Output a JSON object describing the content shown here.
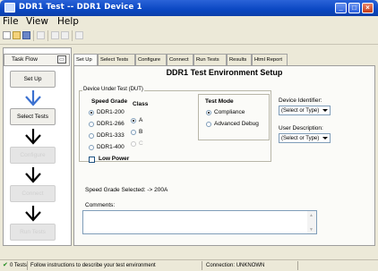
{
  "window": {
    "title": "DDR1 Test -- DDR1 Device 1"
  },
  "menu": [
    "File",
    "View",
    "Help"
  ],
  "task_flow": {
    "label": "Task Flow",
    "steps": [
      {
        "label": "Set Up",
        "enabled": true
      },
      {
        "label": "Select Tests",
        "enabled": true
      },
      {
        "label": "Configure",
        "enabled": false
      },
      {
        "label": "Connect",
        "enabled": false
      },
      {
        "label": "Run Tests",
        "enabled": false
      }
    ]
  },
  "tabs": [
    {
      "label": "Set Up",
      "active": true
    },
    {
      "label": "Select Tests",
      "active": false
    },
    {
      "label": "Configure",
      "active": false
    },
    {
      "label": "Connect",
      "active": false
    },
    {
      "label": "Run Tests",
      "active": false
    },
    {
      "label": "Results",
      "active": false
    },
    {
      "label": "Html Report",
      "active": false
    }
  ],
  "setup": {
    "title": "DDR1 Test Environment Setup",
    "dut_label": "Device Under Test (DUT)",
    "speed_grade": {
      "label": "Speed Grade",
      "options": [
        "DDR1-200",
        "DDR1-266",
        "DDR1-333",
        "DDR1-400"
      ],
      "selected": "DDR1-200"
    },
    "class": {
      "label": "Class",
      "options": [
        "A",
        "B",
        "C"
      ],
      "selected": "A"
    },
    "low_power": {
      "label": "Low Power",
      "checked": false
    },
    "test_mode": {
      "label": "Test Mode",
      "options": [
        "Compliance",
        "Advanced Debug"
      ],
      "selected": "Compliance"
    },
    "device_identifier": {
      "label": "Device Identifier:",
      "value": "(Select or Type)"
    },
    "user_description": {
      "label": "User Description:",
      "value": "(Select or Type)"
    },
    "speed_grade_selected": "Speed Grade Selected: -> 200A",
    "comments_label": "Comments:",
    "comments_value": ""
  },
  "status": {
    "tests": "0 Tests",
    "message": "Follow instructions to describe your test environment",
    "connection": "Connection: UNKNOWN"
  }
}
